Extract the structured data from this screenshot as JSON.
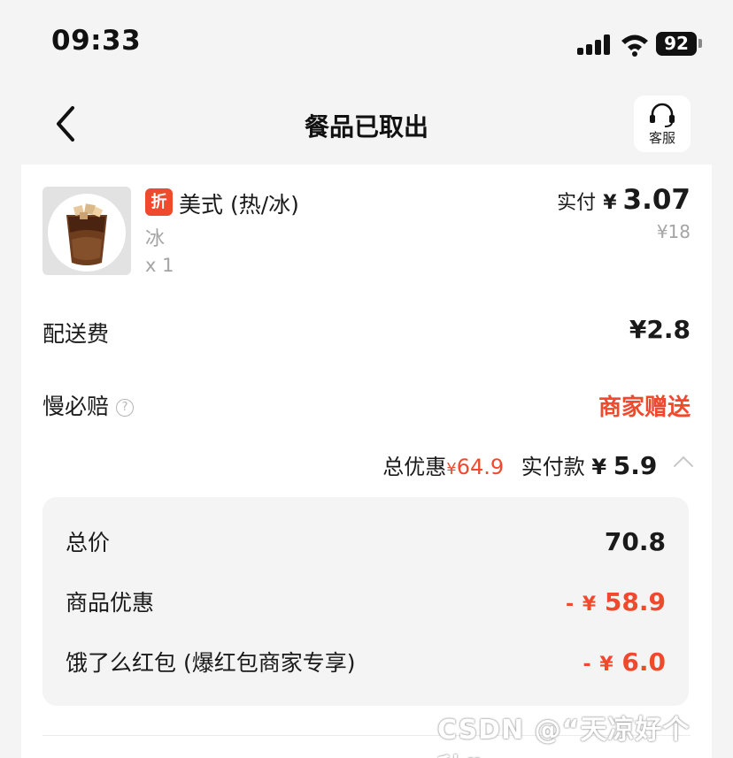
{
  "status_bar": {
    "time": "09:33",
    "battery": "92"
  },
  "nav": {
    "title": "餐品已取出",
    "customer_service_label": "客服"
  },
  "product": {
    "badge": "折",
    "name": "美式 (热/冰)",
    "spec": "冰",
    "quantity": "x 1",
    "paid_label": "实付",
    "paid_currency": "¥",
    "paid_amount": "3.07",
    "original_price": "¥18"
  },
  "fees": {
    "delivery_label": "配送费",
    "delivery_value": "¥2.8",
    "slow_comp_label": "慢必赔",
    "slow_comp_value": "商家赠送"
  },
  "summary": {
    "discount_label": "总优惠",
    "discount_currency": "¥",
    "discount_value": "64.9",
    "pay_label": "实付款",
    "pay_currency": "¥",
    "pay_value": "5.9"
  },
  "breakdown": {
    "total_label": "总价",
    "total_value": "70.8",
    "product_discount_label": "商品优惠",
    "product_discount_prefix": "-",
    "product_discount_currency": "¥",
    "product_discount_value": "58.9",
    "redpacket_label": "饿了么红包 (爆红包商家专享)",
    "redpacket_prefix": "-",
    "redpacket_currency": "¥",
    "redpacket_value": "6.0"
  },
  "watermark": "CSDN @“天凉好个秋”",
  "colors": {
    "accent_red": "#ef4a2e",
    "muted_text": "#a4a4a4",
    "background": "#f4f4f4"
  }
}
